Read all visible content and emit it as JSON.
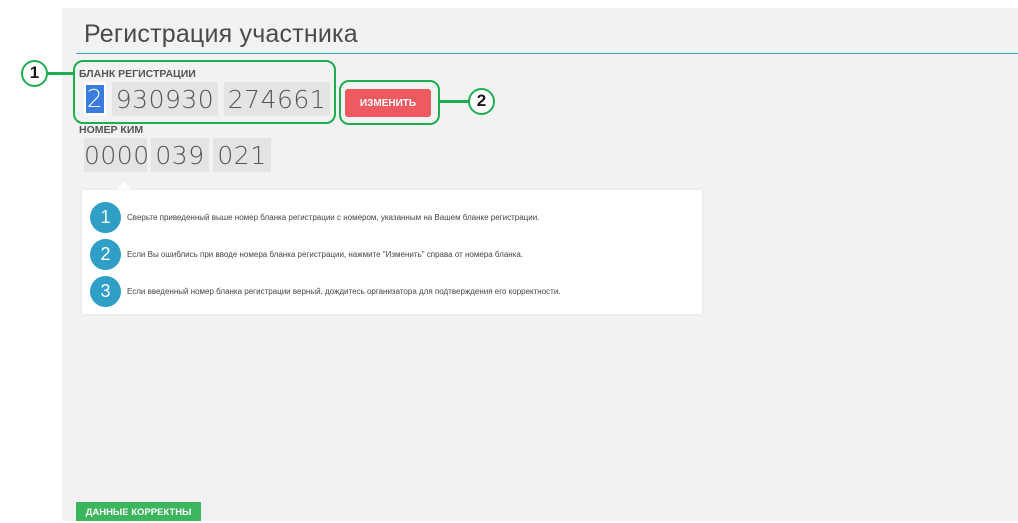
{
  "page": {
    "title": "Регистрация участника"
  },
  "registration_form": {
    "label": "БЛАНК РЕГИСТРАЦИИ",
    "segments": [
      "2",
      "930930",
      "274661"
    ],
    "edit_button": "ИЗМЕНИТЬ"
  },
  "kim": {
    "label": "НОМЕР КИМ",
    "segments": [
      "0000",
      "039",
      "021"
    ]
  },
  "instructions": [
    {
      "num": "1",
      "text": "Сверьте приведенный выше номер бланка регистрации с номером, указанным на Вашем бланке регистрации."
    },
    {
      "num": "2",
      "text": "Если Вы ошиблись при вводе номера бланка регистрации, нажмите \"Изменить\" справа от номера бланка."
    },
    {
      "num": "3",
      "text": "Если введенный номер бланка регистрации верный, дождитесь организатора для подтверждения его корректности."
    }
  ],
  "callouts": [
    "1",
    "2"
  ],
  "confirm_button": "ДАННЫЕ КОРРЕКТНЫ",
  "colors": {
    "accent_line": "#40a9c6",
    "edit_button": "#ef5a60",
    "confirm_button": "#3cb65d",
    "step_circle": "#2f9fc7",
    "callout": "#1fae4e",
    "selection": "#3a7be0"
  }
}
